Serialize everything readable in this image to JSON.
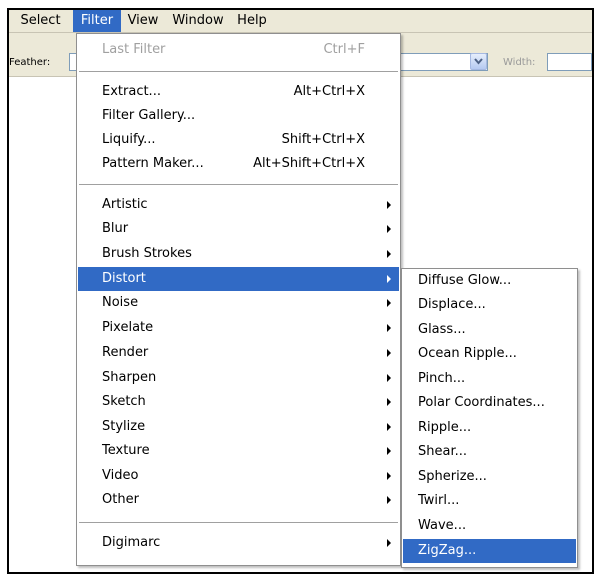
{
  "menubar": {
    "items": [
      {
        "label": "Select"
      },
      {
        "label": "Filter"
      },
      {
        "label": "View"
      },
      {
        "label": "Window"
      },
      {
        "label": "Help"
      }
    ]
  },
  "options": {
    "feather_label": "Feather:",
    "width_label": "Width:"
  },
  "filter_menu": {
    "last_filter": {
      "label": "Last Filter",
      "shortcut": "Ctrl+F"
    },
    "extract": {
      "label": "Extract...",
      "shortcut": "Alt+Ctrl+X"
    },
    "filter_gallery": {
      "label": "Filter Gallery..."
    },
    "liquify": {
      "label": "Liquify...",
      "shortcut": "Shift+Ctrl+X"
    },
    "pattern_maker": {
      "label": "Pattern Maker...",
      "shortcut": "Alt+Shift+Ctrl+X"
    },
    "artistic": {
      "label": "Artistic"
    },
    "blur": {
      "label": "Blur"
    },
    "brush_strokes": {
      "label": "Brush Strokes"
    },
    "distort": {
      "label": "Distort"
    },
    "noise": {
      "label": "Noise"
    },
    "pixelate": {
      "label": "Pixelate"
    },
    "render": {
      "label": "Render"
    },
    "sharpen": {
      "label": "Sharpen"
    },
    "sketch": {
      "label": "Sketch"
    },
    "stylize": {
      "label": "Stylize"
    },
    "texture": {
      "label": "Texture"
    },
    "video": {
      "label": "Video"
    },
    "other": {
      "label": "Other"
    },
    "digimarc": {
      "label": "Digimarc"
    }
  },
  "distort_menu": {
    "items": [
      {
        "label": "Diffuse Glow..."
      },
      {
        "label": "Displace..."
      },
      {
        "label": "Glass..."
      },
      {
        "label": "Ocean Ripple..."
      },
      {
        "label": "Pinch..."
      },
      {
        "label": "Polar Coordinates..."
      },
      {
        "label": "Ripple..."
      },
      {
        "label": "Shear..."
      },
      {
        "label": "Spherize..."
      },
      {
        "label": "Twirl..."
      },
      {
        "label": "Wave..."
      },
      {
        "label": "ZigZag..."
      }
    ]
  },
  "colors": {
    "highlight": "#316ac5",
    "menubar_bg": "#ece9d8",
    "disabled_text": "#a0a0a0"
  }
}
